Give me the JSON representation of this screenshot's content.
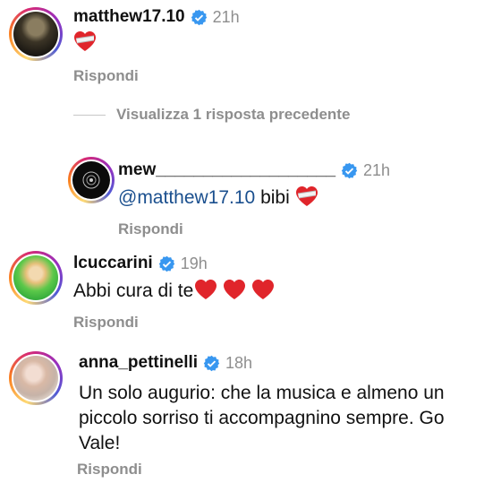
{
  "comments": [
    {
      "username": "matthew17.10",
      "time": "21h",
      "text": "",
      "reply_label": "Rispondi"
    },
    {
      "username": "mew___________________",
      "time": "21h",
      "mention": "@matthew17.10",
      "text": "bibi",
      "reply_label": "Rispondi"
    },
    {
      "username": "lcuccarini",
      "time": "19h",
      "text": "Abbi cura di te",
      "reply_label": "Rispondi"
    },
    {
      "username": "anna_pettinelli",
      "time": "18h",
      "text_lines": [
        "Un solo augurio: che la musica e almeno un",
        "piccolo sorriso ti accompagnino sempre. Go",
        "Vale!"
      ],
      "reply_label": "Rispondi"
    }
  ],
  "view_previous": "Visualizza 1 risposta precedente",
  "icons": {
    "verified": "verified-badge-icon",
    "heart_mended": "mending-heart-icon",
    "heart_red": "red-heart-icon"
  },
  "colors": {
    "verified_blue": "#3897f0",
    "heart_red": "#e0252b",
    "secondary_text": "#8e8e8e",
    "mention": "#1a4f8e"
  }
}
